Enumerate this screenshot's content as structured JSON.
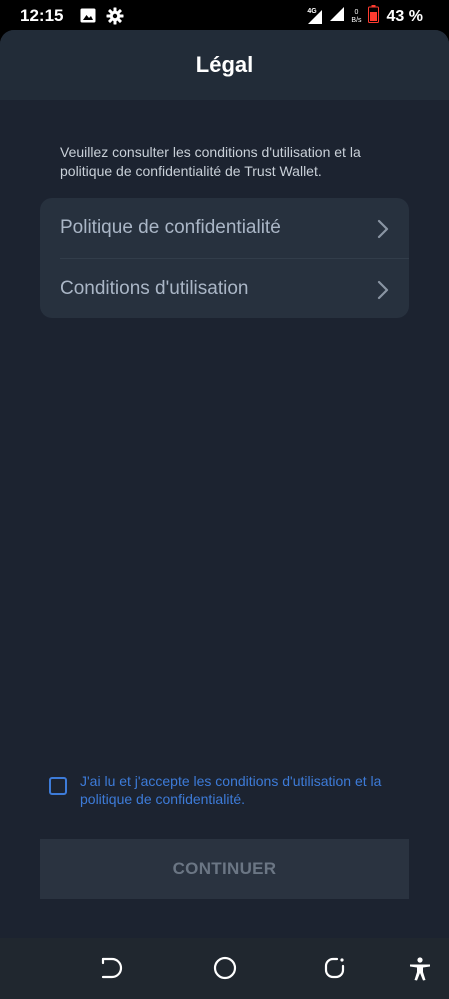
{
  "status_bar": {
    "time": "12:15",
    "network": "4G",
    "speed_value": "0",
    "speed_unit": "B/s",
    "battery_percent": "43 %"
  },
  "header": {
    "title": "Légal"
  },
  "intro_text": "Veuillez consulter les conditions d'utilisation et la politique de confidentialité de Trust Wallet.",
  "links": [
    {
      "label": "Politique de confidentialité"
    },
    {
      "label": "Conditions d'utilisation"
    }
  ],
  "agreement": {
    "text": "J'ai lu et j'accepte les conditions d'utilisation et la politique de confidentialité.",
    "checked": false
  },
  "continue_label": "CONTINUER",
  "colors": {
    "background": "#1c2330",
    "card": "#27313e",
    "accent": "#3d7bd8",
    "disabled_text": "#6b7684"
  },
  "nav_icons": [
    "back-icon",
    "home-icon",
    "recents-icon",
    "accessibility-icon"
  ]
}
